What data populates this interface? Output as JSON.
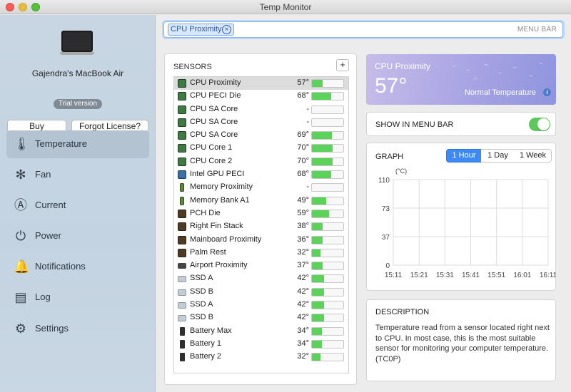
{
  "window": {
    "title": "Temp Monitor"
  },
  "sidebar": {
    "device_name": "Gajendra's MacBook Air",
    "badge": "Trial version",
    "buy_label": "Buy",
    "forgot_label": "Forgot License?",
    "items": [
      {
        "label": "Temperature",
        "icon": "thermometer-icon",
        "glyph": "🌡",
        "active": true
      },
      {
        "label": "Fan",
        "icon": "fan-icon",
        "glyph": "✻"
      },
      {
        "label": "Current",
        "icon": "ampere-icon",
        "glyph": "Ⓐ"
      },
      {
        "label": "Power",
        "icon": "power-plug-icon",
        "glyph": "⏻"
      },
      {
        "label": "Notifications",
        "icon": "bell-icon",
        "glyph": "🔔"
      },
      {
        "label": "Log",
        "icon": "log-icon",
        "glyph": "▤"
      },
      {
        "label": "Settings",
        "icon": "gear-icon",
        "glyph": "⚙"
      }
    ]
  },
  "searchbar": {
    "token": "CPU Proximity",
    "menu_bar_label": "MENU BAR"
  },
  "sensors": {
    "title": "SENSORS",
    "add_label": "+",
    "rows": [
      {
        "name": "CPU Proximity",
        "temp": "57°",
        "level": 0.33,
        "icon": "chip",
        "selected": true
      },
      {
        "name": "CPU PECI Die",
        "temp": "68°",
        "level": 0.62,
        "icon": "chip"
      },
      {
        "name": "CPU SA Core",
        "temp": "-",
        "level": 0,
        "icon": "chip"
      },
      {
        "name": "CPU SA Core",
        "temp": "-",
        "level": 0,
        "icon": "chip"
      },
      {
        "name": "CPU SA Core",
        "temp": "69°",
        "level": 0.64,
        "icon": "chip"
      },
      {
        "name": "CPU Core 1",
        "temp": "70°",
        "level": 0.66,
        "icon": "chip"
      },
      {
        "name": "CPU Core 2",
        "temp": "70°",
        "level": 0.66,
        "icon": "chip"
      },
      {
        "name": "Intel GPU PECI",
        "temp": "68°",
        "level": 0.62,
        "icon": "gpu"
      },
      {
        "name": "Memory Proximity",
        "temp": "-",
        "level": 0,
        "icon": "mem"
      },
      {
        "name": "Memory Bank A1",
        "temp": "49°",
        "level": 0.45,
        "icon": "mem"
      },
      {
        "name": "PCH Die",
        "temp": "59°",
        "level": 0.55,
        "icon": "board"
      },
      {
        "name": "Right Fin Stack",
        "temp": "38°",
        "level": 0.35,
        "icon": "board"
      },
      {
        "name": "Mainboard Proximity",
        "temp": "36°",
        "level": 0.33,
        "icon": "board"
      },
      {
        "name": "Palm Rest",
        "temp": "32°",
        "level": 0.28,
        "icon": "board"
      },
      {
        "name": "Airport Proximity",
        "temp": "37°",
        "level": 0.34,
        "icon": "air"
      },
      {
        "name": "SSD A",
        "temp": "42°",
        "level": 0.38,
        "icon": "ssd"
      },
      {
        "name": "SSD B",
        "temp": "42°",
        "level": 0.38,
        "icon": "ssd"
      },
      {
        "name": "SSD A",
        "temp": "42°",
        "level": 0.38,
        "icon": "ssd"
      },
      {
        "name": "SSD B",
        "temp": "42°",
        "level": 0.38,
        "icon": "ssd"
      },
      {
        "name": "Battery Max",
        "temp": "34°",
        "level": 0.31,
        "icon": "batt"
      },
      {
        "name": "Battery 1",
        "temp": "34°",
        "level": 0.31,
        "icon": "batt"
      },
      {
        "name": "Battery 2",
        "temp": "32°",
        "level": 0.28,
        "icon": "batt"
      }
    ]
  },
  "current": {
    "sensor": "CPU Proximity",
    "temp": "57°",
    "status": "Normal Temperature"
  },
  "menu_bar_toggle": {
    "label": "SHOW IN MENU BAR",
    "on": true
  },
  "graph": {
    "title": "GRAPH",
    "ranges": [
      "1 Hour",
      "1 Day",
      "1 Week"
    ],
    "selected_range": "1 Hour"
  },
  "chart_data": {
    "type": "line",
    "ylabel": "(°C)",
    "y_ticks": [
      "110",
      "73",
      "37",
      "0"
    ],
    "ylim": [
      0,
      110
    ],
    "x_ticks": [
      "15:11",
      "15:21",
      "15:31",
      "15:41",
      "15:51",
      "16:01",
      "16:11"
    ],
    "grid": true,
    "series": []
  },
  "description": {
    "title": "DESCRIPTION",
    "text": "Temperature read from a sensor located right next to CPU. In most case, this is the most suitable sensor for monitoring your computer temperature. (TC0P)"
  },
  "colors": {
    "accent": "#3d8af7",
    "bar_fill": "#5bd35b",
    "toggle_on": "#5ac85a"
  }
}
